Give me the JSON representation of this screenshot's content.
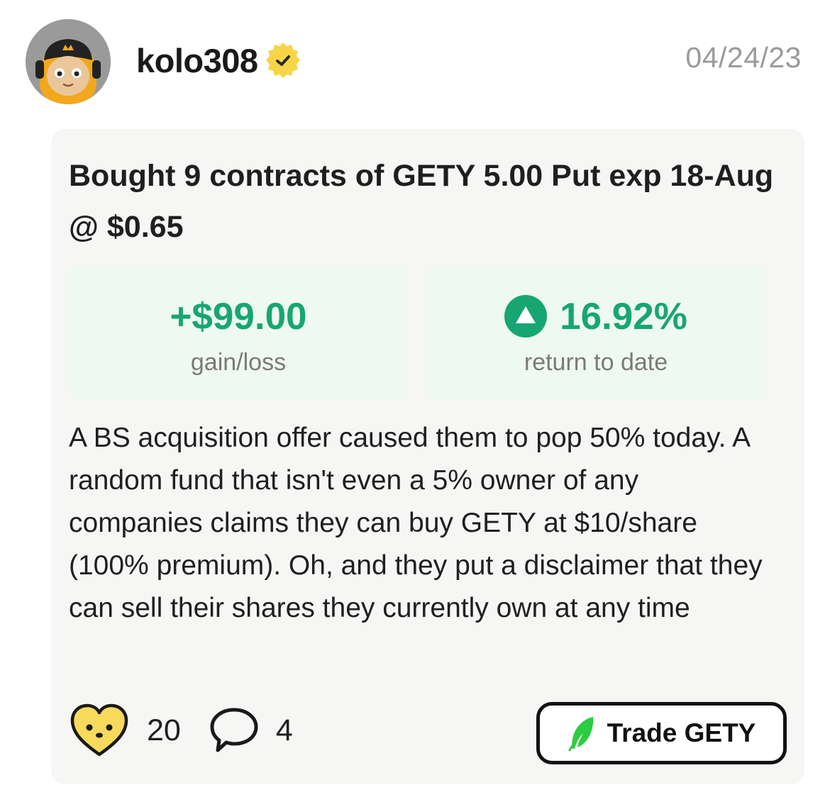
{
  "post": {
    "username": "kolo308",
    "date": "04/24/23",
    "title": "Bought 9 contracts of GETY 5.00 Put exp 18-Aug @ $0.65",
    "gain": {
      "value": "+$99.00",
      "label": "gain/loss"
    },
    "return": {
      "value": "16.92%",
      "label": "return to date"
    },
    "body": "A BS acquisition offer caused them to pop 50% today. A random fund that isn't even a 5% owner of any companies claims they can buy GETY at $10/share (100% premium). Oh, and they put a disclaimer that they can sell their shares they currently own at any time",
    "likes": "20",
    "comments": "4",
    "trade_label": "Trade GETY"
  },
  "icons": {
    "avatar": "hooded-character-avatar",
    "verified": "verified-badge-icon",
    "up": "triangle-up-icon",
    "like": "heart-face-icon",
    "comment": "speech-bubble-icon",
    "trade": "robinhood-feather-icon"
  },
  "colors": {
    "positive": "#17a673",
    "positive_bg": "#eef9f1",
    "card_bg": "#f6f6f5",
    "verified": "#f7d548",
    "heart": "#f7d95c",
    "feather": "#2ecc40",
    "muted": "#9b9b9b"
  }
}
